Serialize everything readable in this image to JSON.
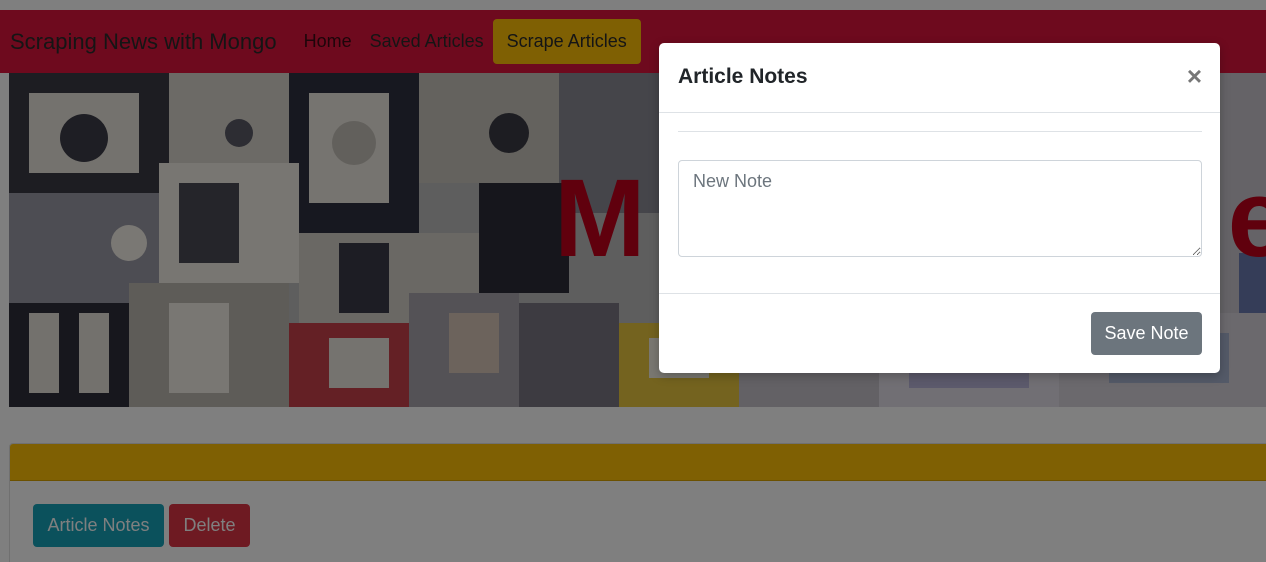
{
  "navbar": {
    "brand": "Scraping News with Mongo",
    "links": [
      {
        "label": "Home"
      },
      {
        "label": "Saved Articles"
      }
    ],
    "scrape_button": "Scrape Articles",
    "color": "#dc143c",
    "scrape_color": "#ffc107"
  },
  "hero": {
    "title_fragment_left": "M",
    "title_fragment_right": "e"
  },
  "article_card": {
    "notes_button": "Article Notes",
    "delete_button": "Delete",
    "header_color": "#ffc107",
    "notes_color": "#17a2b8",
    "delete_color": "#dc3545"
  },
  "modal": {
    "title": "Article Notes",
    "close_icon": "close-icon",
    "note_placeholder": "New Note",
    "note_value": "",
    "save_button": "Save Note",
    "save_color": "#6c757d"
  }
}
